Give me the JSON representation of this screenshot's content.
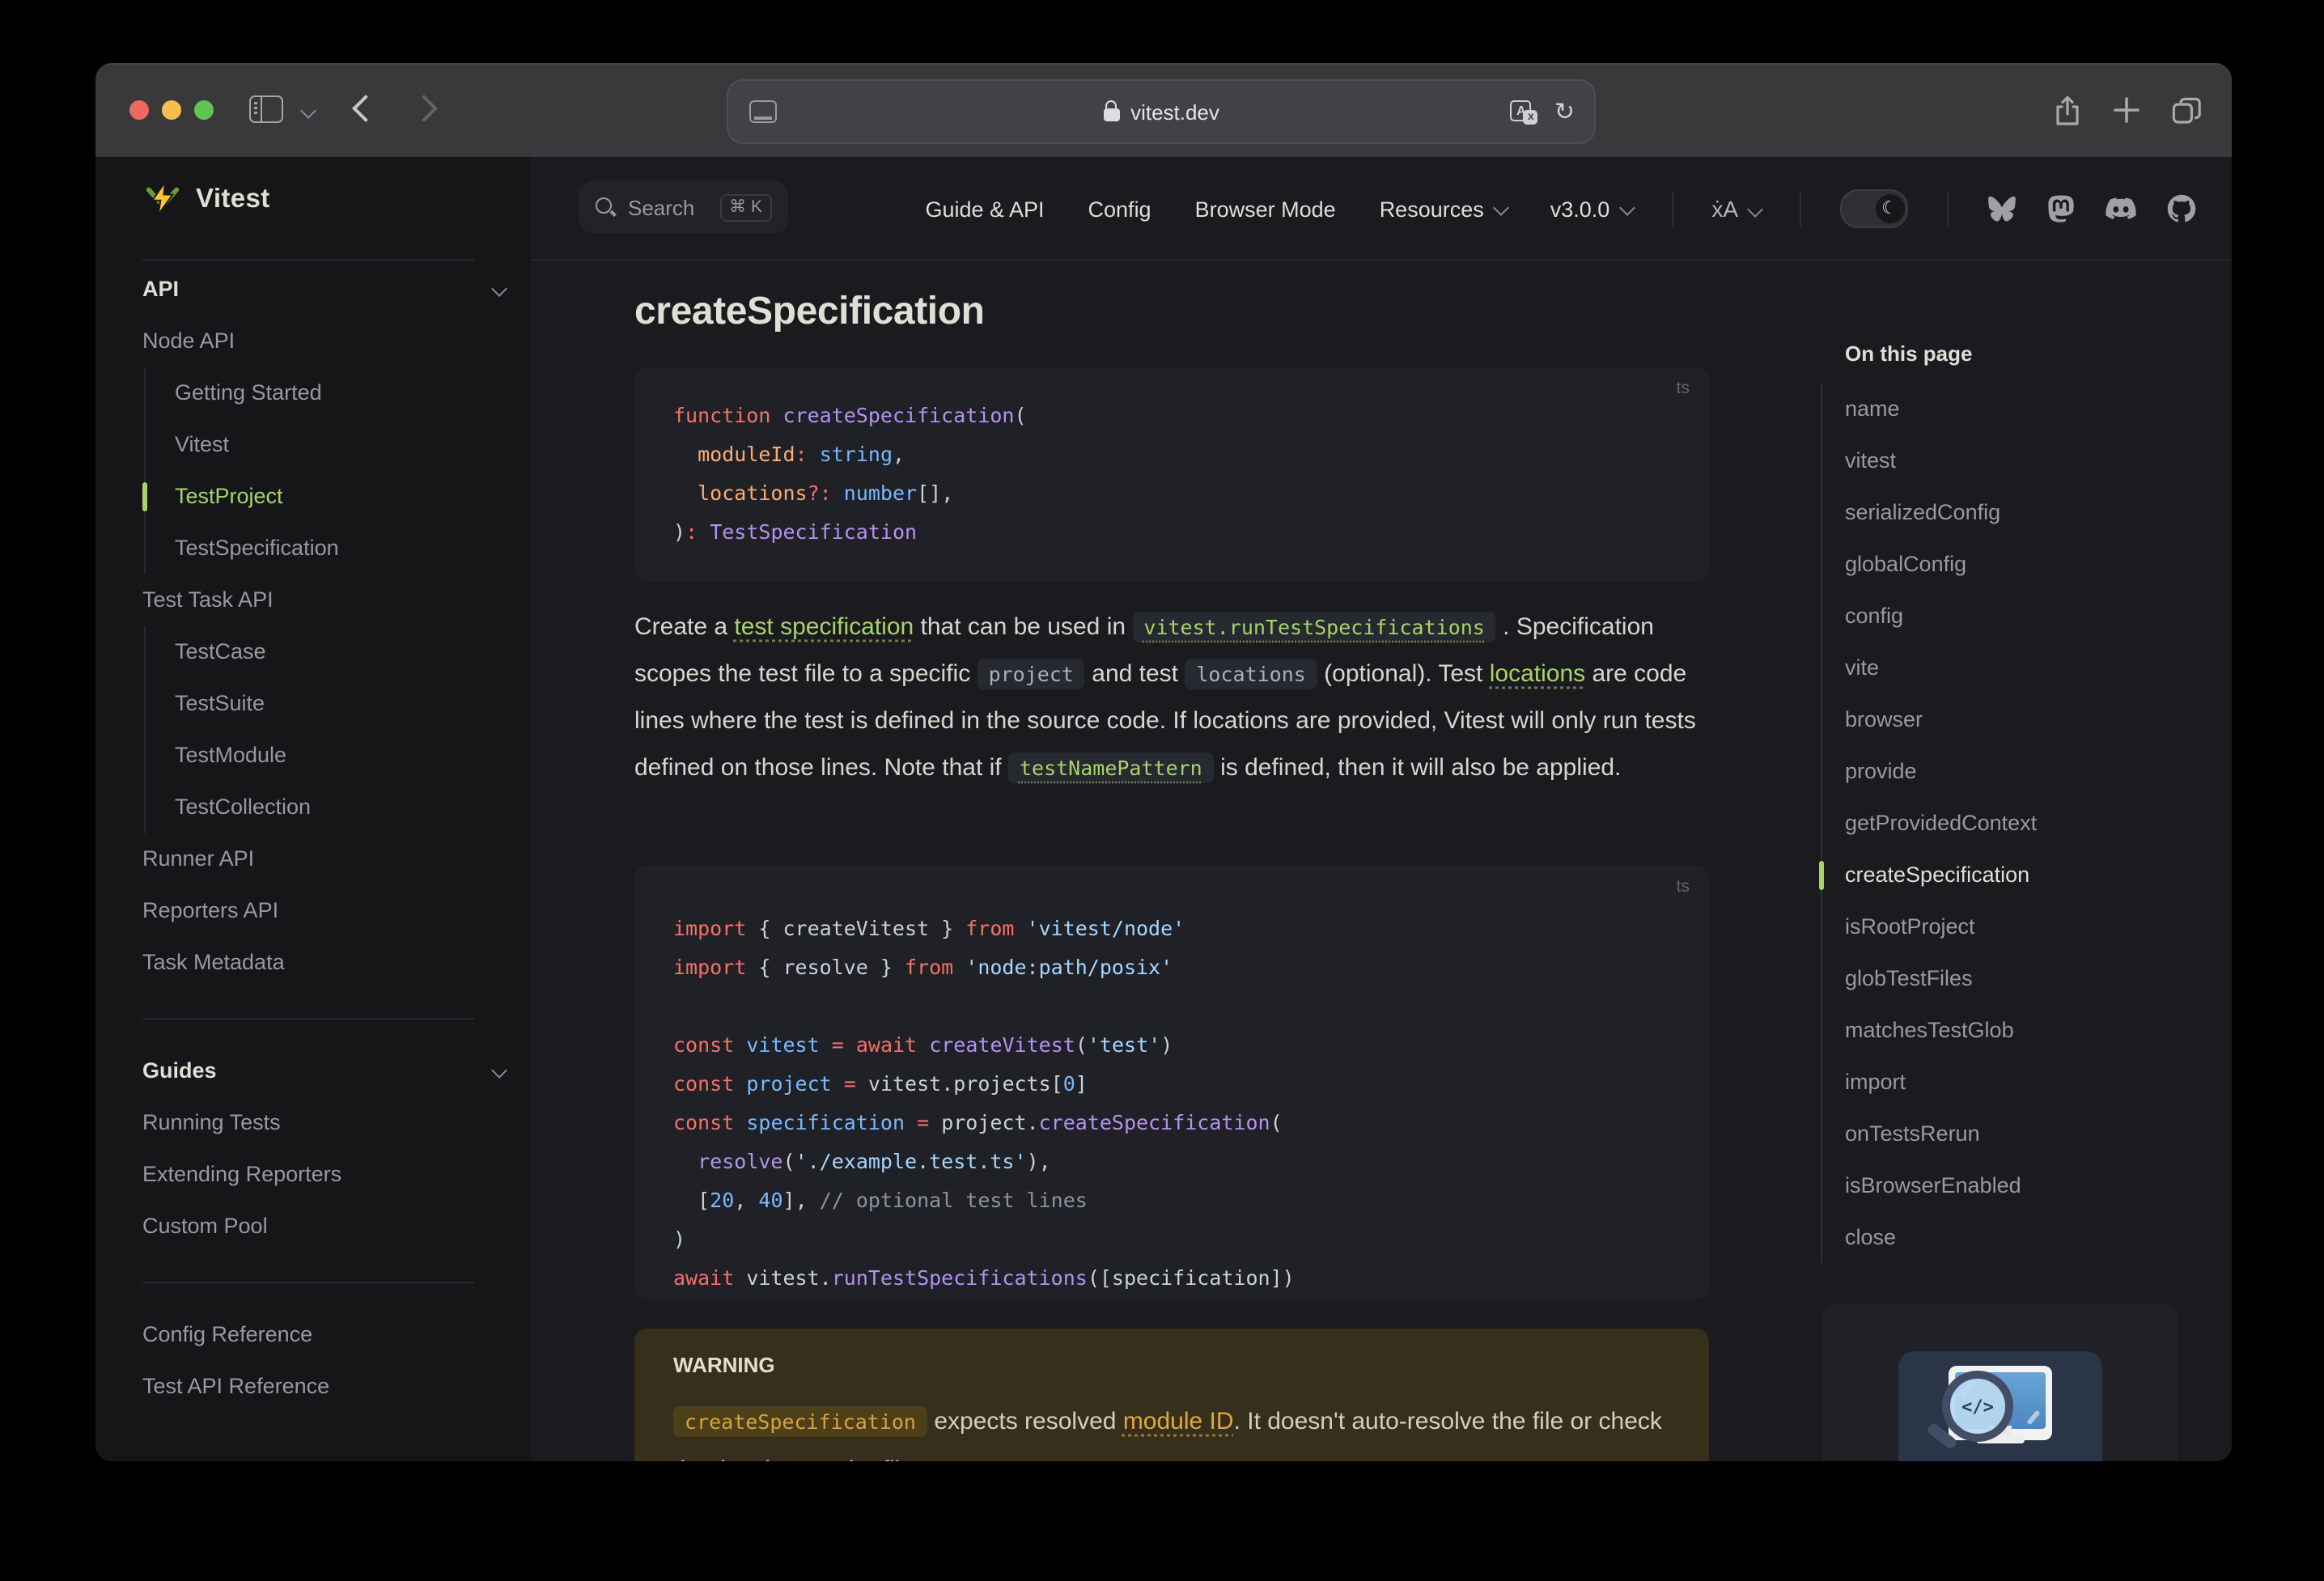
{
  "window": {
    "url": "vitest.dev"
  },
  "logo": {
    "text": "Vitest"
  },
  "navbar": {
    "search": {
      "label": "Search",
      "shortcut": "⌘ K"
    },
    "links": [
      {
        "label": "Guide & API"
      },
      {
        "label": "Config"
      },
      {
        "label": "Browser Mode"
      },
      {
        "label": "Resources",
        "chevron": true
      },
      {
        "label": "v3.0.0",
        "chevron": true
      }
    ],
    "language_label": "ẋA"
  },
  "sidebar": {
    "items": [
      {
        "type": "section",
        "label": "API",
        "chevron": true
      },
      {
        "type": "top",
        "label": "Node API"
      },
      {
        "type": "sub",
        "label": "Getting Started"
      },
      {
        "type": "sub",
        "label": "Vitest"
      },
      {
        "type": "sub",
        "label": "TestProject",
        "active": true
      },
      {
        "type": "sub",
        "label": "TestSpecification"
      },
      {
        "type": "top",
        "label": "Test Task API"
      },
      {
        "type": "sub",
        "label": "TestCase"
      },
      {
        "type": "sub",
        "label": "TestSuite"
      },
      {
        "type": "sub",
        "label": "TestModule"
      },
      {
        "type": "sub",
        "label": "TestCollection"
      },
      {
        "type": "top",
        "label": "Runner API"
      },
      {
        "type": "top",
        "label": "Reporters API"
      },
      {
        "type": "top",
        "label": "Task Metadata"
      },
      {
        "type": "divider"
      },
      {
        "type": "section",
        "label": "Guides",
        "chevron": true
      },
      {
        "type": "top",
        "label": "Running Tests"
      },
      {
        "type": "top",
        "label": "Extending Reporters"
      },
      {
        "type": "top",
        "label": "Custom Pool"
      },
      {
        "type": "divider"
      },
      {
        "type": "top",
        "label": "Config Reference"
      },
      {
        "type": "top",
        "label": "Test API Reference"
      }
    ]
  },
  "page": {
    "title": "createSpecification",
    "code_blocks": [
      {
        "lang": "ts",
        "lines": [
          [
            [
              "k",
              "function"
            ],
            [
              "d",
              " "
            ],
            [
              "f",
              "createSpecification"
            ],
            [
              "d",
              "("
            ]
          ],
          [
            [
              "d",
              "  "
            ],
            [
              "o",
              "moduleId"
            ],
            [
              "k",
              ":"
            ],
            [
              "d",
              " "
            ],
            [
              "b",
              "string"
            ],
            [
              "d",
              ","
            ]
          ],
          [
            [
              "d",
              "  "
            ],
            [
              "o",
              "locations"
            ],
            [
              "k",
              "?:"
            ],
            [
              "d",
              " "
            ],
            [
              "b",
              "number"
            ],
            [
              "d",
              "[],"
            ]
          ],
          [
            [
              "d",
              ")"
            ],
            [
              "k",
              ":"
            ],
            [
              "d",
              " "
            ],
            [
              "f",
              "TestSpecification"
            ]
          ]
        ]
      },
      {
        "lang": "ts",
        "lines": [
          [
            [
              "k",
              "import"
            ],
            [
              "d",
              " { createVitest } "
            ],
            [
              "k",
              "from"
            ],
            [
              "d",
              " "
            ],
            [
              "s",
              "'vitest/node'"
            ]
          ],
          [
            [
              "k",
              "import"
            ],
            [
              "d",
              " { resolve } "
            ],
            [
              "k",
              "from"
            ],
            [
              "d",
              " "
            ],
            [
              "s",
              "'node:path/posix'"
            ]
          ],
          [],
          [
            [
              "k",
              "const"
            ],
            [
              "d",
              " "
            ],
            [
              "b",
              "vitest"
            ],
            [
              "d",
              " "
            ],
            [
              "k",
              "="
            ],
            [
              "d",
              " "
            ],
            [
              "k",
              "await"
            ],
            [
              "d",
              " "
            ],
            [
              "f",
              "createVitest"
            ],
            [
              "d",
              "("
            ],
            [
              "s",
              "'test'"
            ],
            [
              "d",
              ")"
            ]
          ],
          [
            [
              "k",
              "const"
            ],
            [
              "d",
              " "
            ],
            [
              "b",
              "project"
            ],
            [
              "d",
              " "
            ],
            [
              "k",
              "="
            ],
            [
              "d",
              " vitest.projects["
            ],
            [
              "b",
              "0"
            ],
            [
              "d",
              "]"
            ]
          ],
          [
            [
              "k",
              "const"
            ],
            [
              "d",
              " "
            ],
            [
              "b",
              "specification"
            ],
            [
              "d",
              " "
            ],
            [
              "k",
              "="
            ],
            [
              "d",
              " project."
            ],
            [
              "f",
              "createSpecification"
            ],
            [
              "d",
              "("
            ]
          ],
          [
            [
              "d",
              "  "
            ],
            [
              "f",
              "resolve"
            ],
            [
              "d",
              "("
            ],
            [
              "s",
              "'./example.test.ts'"
            ],
            [
              "d",
              "),"
            ]
          ],
          [
            [
              "d",
              "  ["
            ],
            [
              "b",
              "20"
            ],
            [
              "d",
              ", "
            ],
            [
              "b",
              "40"
            ],
            [
              "d",
              "], "
            ],
            [
              "c",
              "// optional test lines"
            ]
          ],
          [
            [
              "d",
              ")"
            ]
          ],
          [
            [
              "k",
              "await"
            ],
            [
              "d",
              " vitest."
            ],
            [
              "f",
              "runTestSpecifications"
            ],
            [
              "d",
              "([specification])"
            ]
          ]
        ]
      }
    ],
    "paragraph": [
      {
        "s": "text",
        "t": "Create a "
      },
      {
        "s": "link",
        "t": "test specification"
      },
      {
        "s": "text",
        "t": " that can be used in "
      },
      {
        "s": "codelink",
        "t": "vitest.runTestSpecifications"
      },
      {
        "s": "text",
        "t": " . Specification scopes the test file to a specific "
      },
      {
        "s": "code",
        "t": "project"
      },
      {
        "s": "text",
        "t": " and test "
      },
      {
        "s": "code",
        "t": "locations"
      },
      {
        "s": "text",
        "t": " (optional). Test "
      },
      {
        "s": "link",
        "t": "locations"
      },
      {
        "s": "text",
        "t": " are code lines where the test is defined in the source code. If locations are provided, Vitest will only run tests defined on those lines. Note that if "
      },
      {
        "s": "codelink",
        "t": "testNamePattern"
      },
      {
        "s": "text",
        "t": " is defined, then it will also be applied."
      }
    ],
    "warning": {
      "title": "WARNING",
      "segments": [
        {
          "s": "warnchip",
          "t": "createSpecification"
        },
        {
          "s": "text",
          "t": " expects resolved "
        },
        {
          "s": "warnlink",
          "t": "module ID"
        },
        {
          "s": "text",
          "t": ". It doesn't auto-resolve the file or check that it exists on the file system."
        }
      ]
    }
  },
  "aside": {
    "title": "On this page",
    "items": [
      "name",
      "vitest",
      "serializedConfig",
      "globalConfig",
      "config",
      "vite",
      "browser",
      "provide",
      "getProvidedContext",
      "createSpecification",
      "isRootProject",
      "globTestFiles",
      "matchesTestGlob",
      "import",
      "onTestsRerun",
      "isBrowserEnabled",
      "close"
    ],
    "active": "createSpecification"
  },
  "colors": {
    "brand_green": "#a8d36a",
    "logo_yellow": "#fcc72b",
    "logo_green": "#669e35",
    "code_bg": "#202127",
    "warning_bg": "#362f1b",
    "warning_accent": "#d9a23f",
    "syntax": {
      "keyword": "#f47067",
      "function": "#b392f0",
      "parameter": "#ffab70",
      "type_number": "#79b8ff",
      "string": "#a5d6ff",
      "comment": "#8b949e",
      "default": "#c9d1d9"
    }
  }
}
